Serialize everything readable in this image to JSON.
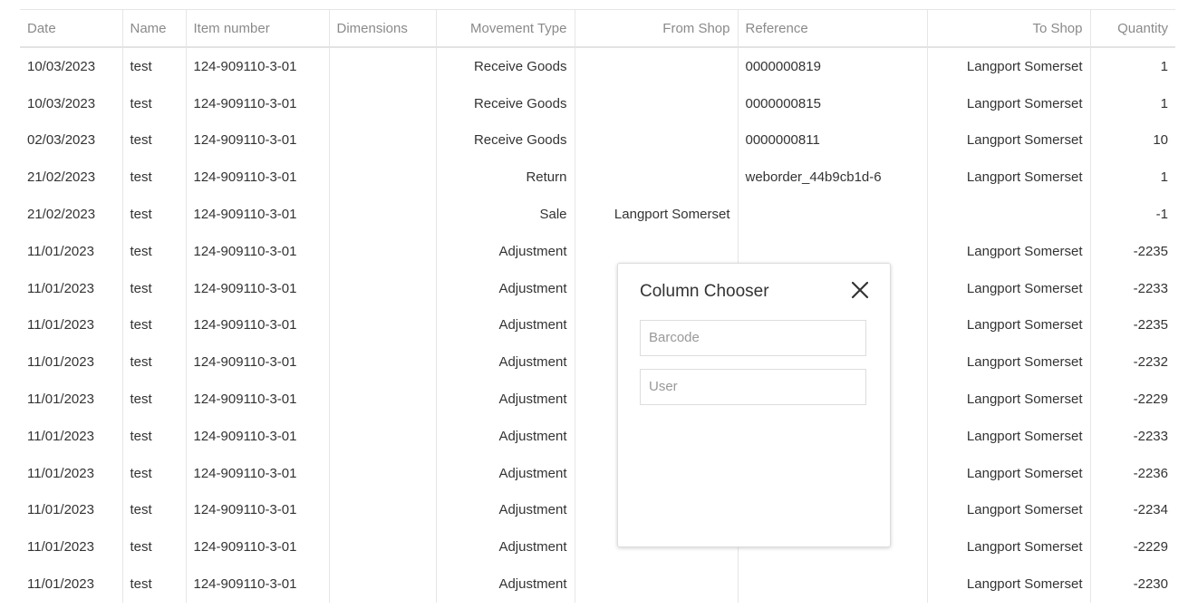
{
  "grid": {
    "columns": [
      "Date",
      "Name",
      "Item number",
      "Dimensions",
      "Movement Type",
      "From Shop",
      "Reference",
      "To Shop",
      "Quantity"
    ],
    "rows": [
      [
        "10/03/2023",
        "test",
        "124-909110-3-01",
        "",
        "Receive Goods",
        "",
        "0000000819",
        "Langport Somerset",
        "1"
      ],
      [
        "10/03/2023",
        "test",
        "124-909110-3-01",
        "",
        "Receive Goods",
        "",
        "0000000815",
        "Langport Somerset",
        "1"
      ],
      [
        "02/03/2023",
        "test",
        "124-909110-3-01",
        "",
        "Receive Goods",
        "",
        "0000000811",
        "Langport Somerset",
        "10"
      ],
      [
        "21/02/2023",
        "test",
        "124-909110-3-01",
        "",
        "Return",
        "",
        "weborder_44b9cb1d-6",
        "Langport Somerset",
        "1"
      ],
      [
        "21/02/2023",
        "test",
        "124-909110-3-01",
        "",
        "Sale",
        "Langport Somerset",
        "",
        "",
        "-1"
      ],
      [
        "11/01/2023",
        "test",
        "124-909110-3-01",
        "",
        "Adjustment",
        "",
        "",
        "Langport Somerset",
        "-2235"
      ],
      [
        "11/01/2023",
        "test",
        "124-909110-3-01",
        "",
        "Adjustment",
        "",
        "",
        "Langport Somerset",
        "-2233"
      ],
      [
        "11/01/2023",
        "test",
        "124-909110-3-01",
        "",
        "Adjustment",
        "",
        "",
        "Langport Somerset",
        "-2235"
      ],
      [
        "11/01/2023",
        "test",
        "124-909110-3-01",
        "",
        "Adjustment",
        "",
        "",
        "Langport Somerset",
        "-2232"
      ],
      [
        "11/01/2023",
        "test",
        "124-909110-3-01",
        "",
        "Adjustment",
        "",
        "",
        "Langport Somerset",
        "-2229"
      ],
      [
        "11/01/2023",
        "test",
        "124-909110-3-01",
        "",
        "Adjustment",
        "",
        "",
        "Langport Somerset",
        "-2233"
      ],
      [
        "11/01/2023",
        "test",
        "124-909110-3-01",
        "",
        "Adjustment",
        "",
        "",
        "Langport Somerset",
        "-2236"
      ],
      [
        "11/01/2023",
        "test",
        "124-909110-3-01",
        "",
        "Adjustment",
        "",
        "",
        "Langport Somerset",
        "-2234"
      ],
      [
        "11/01/2023",
        "test",
        "124-909110-3-01",
        "",
        "Adjustment",
        "",
        "",
        "Langport Somerset",
        "-2229"
      ],
      [
        "11/01/2023",
        "test",
        "124-909110-3-01",
        "",
        "Adjustment",
        "",
        "",
        "Langport Somerset",
        "-2230"
      ]
    ]
  },
  "column_chooser": {
    "title": "Column Chooser",
    "close_icon": "close-icon",
    "items": [
      "Barcode",
      "User"
    ]
  }
}
